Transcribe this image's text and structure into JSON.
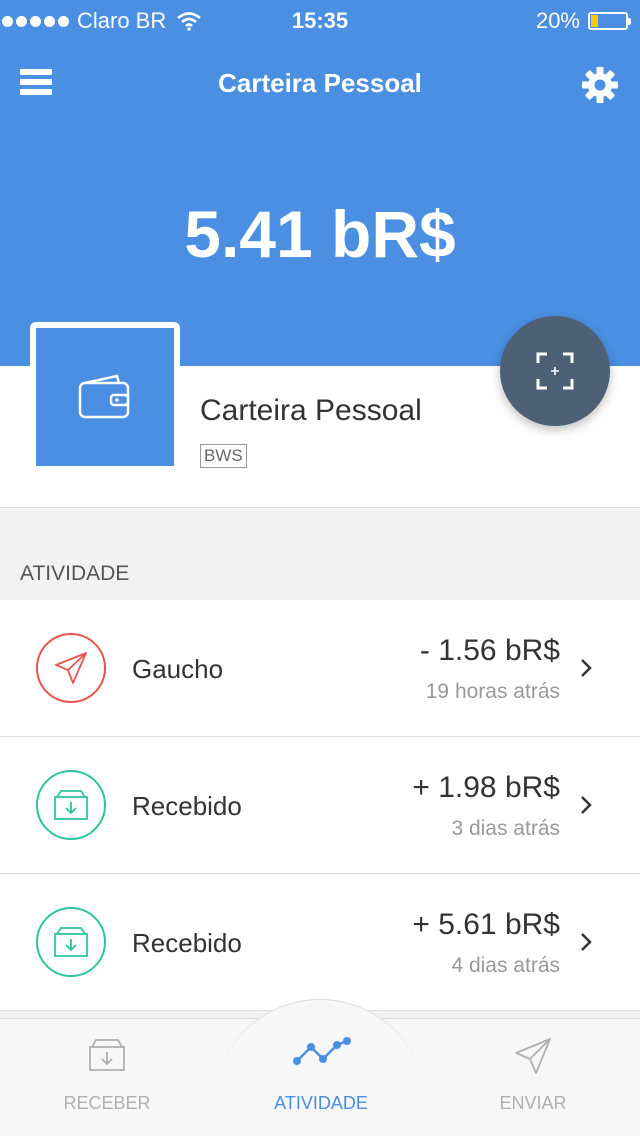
{
  "status_bar": {
    "carrier": "Claro BR",
    "time": "15:35",
    "battery": "20%"
  },
  "navbar": {
    "title": "Carteira Pessoal"
  },
  "balance": "5.41 bR$",
  "wallet": {
    "name": "Carteira Pessoal",
    "badge": "BWS"
  },
  "section_label": "ATIVIDADE",
  "activities": [
    {
      "type": "sent",
      "label": "Gaucho",
      "amount": "- 1.56 bR$",
      "time": "19 horas atrás"
    },
    {
      "type": "received",
      "label": "Recebido",
      "amount": "+ 1.98 bR$",
      "time": "3 dias atrás"
    },
    {
      "type": "received",
      "label": "Recebido",
      "amount": "+ 5.61 bR$",
      "time": "4 dias atrás"
    }
  ],
  "tabs": [
    {
      "label": "RECEBER",
      "icon": "inbox-icon"
    },
    {
      "label": "ATIVIDADE",
      "icon": "activity-chart-icon"
    },
    {
      "label": "ENVIAR",
      "icon": "send-icon"
    }
  ],
  "colors": {
    "brand_blue": "#4a8fe2",
    "sent_red": "#e9544f",
    "received_green": "#2ec4a0",
    "scan_button": "#4d6075"
  }
}
